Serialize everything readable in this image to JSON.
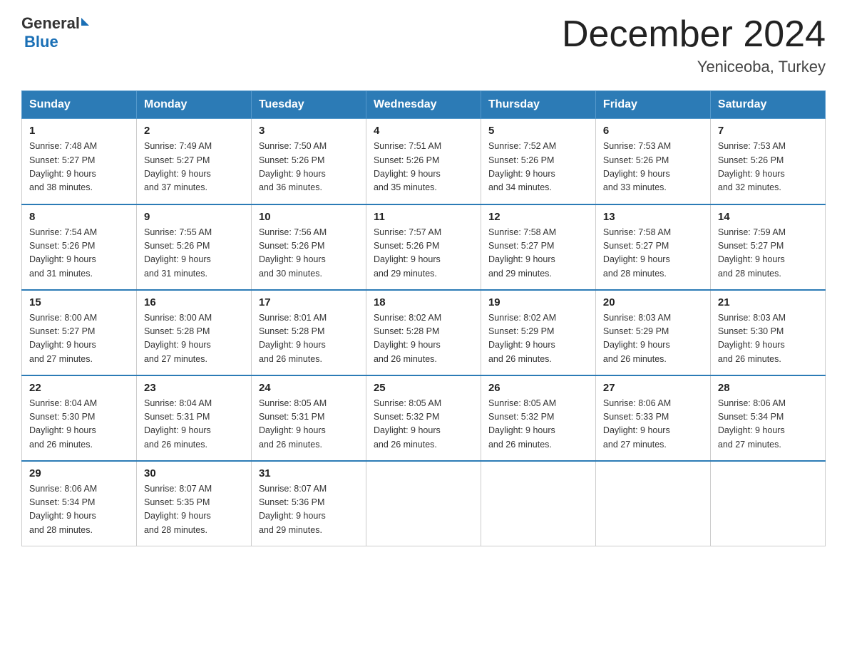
{
  "header": {
    "logo_general": "General",
    "logo_blue": "Blue",
    "month_title": "December 2024",
    "location": "Yeniceoba, Turkey"
  },
  "weekdays": [
    "Sunday",
    "Monday",
    "Tuesday",
    "Wednesday",
    "Thursday",
    "Friday",
    "Saturday"
  ],
  "weeks": [
    [
      {
        "day": "1",
        "sunrise": "7:48 AM",
        "sunset": "5:27 PM",
        "daylight": "9 hours and 38 minutes."
      },
      {
        "day": "2",
        "sunrise": "7:49 AM",
        "sunset": "5:27 PM",
        "daylight": "9 hours and 37 minutes."
      },
      {
        "day": "3",
        "sunrise": "7:50 AM",
        "sunset": "5:26 PM",
        "daylight": "9 hours and 36 minutes."
      },
      {
        "day": "4",
        "sunrise": "7:51 AM",
        "sunset": "5:26 PM",
        "daylight": "9 hours and 35 minutes."
      },
      {
        "day": "5",
        "sunrise": "7:52 AM",
        "sunset": "5:26 PM",
        "daylight": "9 hours and 34 minutes."
      },
      {
        "day": "6",
        "sunrise": "7:53 AM",
        "sunset": "5:26 PM",
        "daylight": "9 hours and 33 minutes."
      },
      {
        "day": "7",
        "sunrise": "7:53 AM",
        "sunset": "5:26 PM",
        "daylight": "9 hours and 32 minutes."
      }
    ],
    [
      {
        "day": "8",
        "sunrise": "7:54 AM",
        "sunset": "5:26 PM",
        "daylight": "9 hours and 31 minutes."
      },
      {
        "day": "9",
        "sunrise": "7:55 AM",
        "sunset": "5:26 PM",
        "daylight": "9 hours and 31 minutes."
      },
      {
        "day": "10",
        "sunrise": "7:56 AM",
        "sunset": "5:26 PM",
        "daylight": "9 hours and 30 minutes."
      },
      {
        "day": "11",
        "sunrise": "7:57 AM",
        "sunset": "5:26 PM",
        "daylight": "9 hours and 29 minutes."
      },
      {
        "day": "12",
        "sunrise": "7:58 AM",
        "sunset": "5:27 PM",
        "daylight": "9 hours and 29 minutes."
      },
      {
        "day": "13",
        "sunrise": "7:58 AM",
        "sunset": "5:27 PM",
        "daylight": "9 hours and 28 minutes."
      },
      {
        "day": "14",
        "sunrise": "7:59 AM",
        "sunset": "5:27 PM",
        "daylight": "9 hours and 28 minutes."
      }
    ],
    [
      {
        "day": "15",
        "sunrise": "8:00 AM",
        "sunset": "5:27 PM",
        "daylight": "9 hours and 27 minutes."
      },
      {
        "day": "16",
        "sunrise": "8:00 AM",
        "sunset": "5:28 PM",
        "daylight": "9 hours and 27 minutes."
      },
      {
        "day": "17",
        "sunrise": "8:01 AM",
        "sunset": "5:28 PM",
        "daylight": "9 hours and 26 minutes."
      },
      {
        "day": "18",
        "sunrise": "8:02 AM",
        "sunset": "5:28 PM",
        "daylight": "9 hours and 26 minutes."
      },
      {
        "day": "19",
        "sunrise": "8:02 AM",
        "sunset": "5:29 PM",
        "daylight": "9 hours and 26 minutes."
      },
      {
        "day": "20",
        "sunrise": "8:03 AM",
        "sunset": "5:29 PM",
        "daylight": "9 hours and 26 minutes."
      },
      {
        "day": "21",
        "sunrise": "8:03 AM",
        "sunset": "5:30 PM",
        "daylight": "9 hours and 26 minutes."
      }
    ],
    [
      {
        "day": "22",
        "sunrise": "8:04 AM",
        "sunset": "5:30 PM",
        "daylight": "9 hours and 26 minutes."
      },
      {
        "day": "23",
        "sunrise": "8:04 AM",
        "sunset": "5:31 PM",
        "daylight": "9 hours and 26 minutes."
      },
      {
        "day": "24",
        "sunrise": "8:05 AM",
        "sunset": "5:31 PM",
        "daylight": "9 hours and 26 minutes."
      },
      {
        "day": "25",
        "sunrise": "8:05 AM",
        "sunset": "5:32 PM",
        "daylight": "9 hours and 26 minutes."
      },
      {
        "day": "26",
        "sunrise": "8:05 AM",
        "sunset": "5:32 PM",
        "daylight": "9 hours and 26 minutes."
      },
      {
        "day": "27",
        "sunrise": "8:06 AM",
        "sunset": "5:33 PM",
        "daylight": "9 hours and 27 minutes."
      },
      {
        "day": "28",
        "sunrise": "8:06 AM",
        "sunset": "5:34 PM",
        "daylight": "9 hours and 27 minutes."
      }
    ],
    [
      {
        "day": "29",
        "sunrise": "8:06 AM",
        "sunset": "5:34 PM",
        "daylight": "9 hours and 28 minutes."
      },
      {
        "day": "30",
        "sunrise": "8:07 AM",
        "sunset": "5:35 PM",
        "daylight": "9 hours and 28 minutes."
      },
      {
        "day": "31",
        "sunrise": "8:07 AM",
        "sunset": "5:36 PM",
        "daylight": "9 hours and 29 minutes."
      },
      null,
      null,
      null,
      null
    ]
  ],
  "labels": {
    "sunrise": "Sunrise: ",
    "sunset": "Sunset: ",
    "daylight": "Daylight: "
  }
}
